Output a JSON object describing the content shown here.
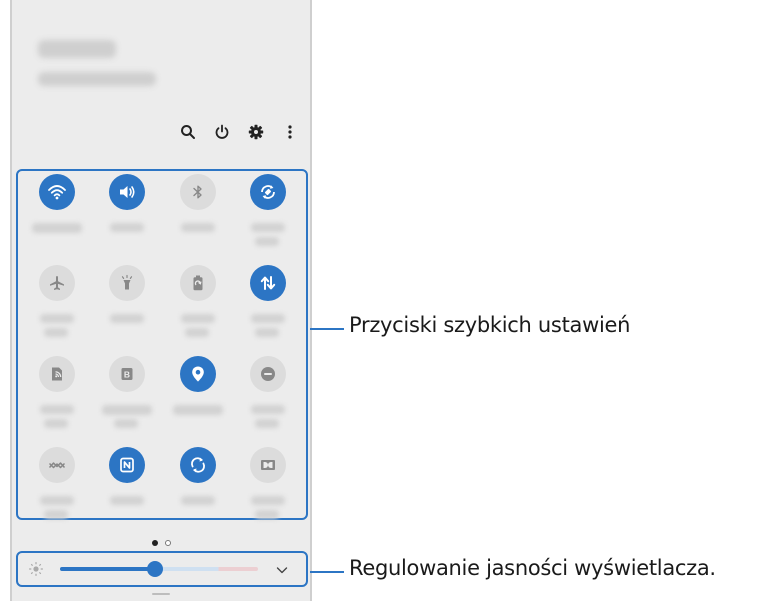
{
  "colors": {
    "accent": "#2c75c4",
    "tile_off": "#dcdcdc",
    "panel_bg": "#ececec"
  },
  "header": {
    "top_icons": [
      "search-icon",
      "power-icon",
      "gear-icon",
      "more-vert-icon"
    ]
  },
  "quick_settings": {
    "tiles": [
      {
        "icon": "wifi-icon",
        "on": true
      },
      {
        "icon": "volume-icon",
        "on": true
      },
      {
        "icon": "bluetooth-icon",
        "on": false
      },
      {
        "icon": "auto-rotate-icon",
        "on": true
      },
      {
        "icon": "airplane-icon",
        "on": false
      },
      {
        "icon": "flashlight-icon",
        "on": false
      },
      {
        "icon": "power-saving-icon",
        "on": false
      },
      {
        "icon": "mobile-data-icon",
        "on": true
      },
      {
        "icon": "mobile-hotspot-icon",
        "on": false
      },
      {
        "icon": "blue-light-filter-icon",
        "on": false
      },
      {
        "icon": "location-icon",
        "on": true
      },
      {
        "icon": "do-not-disturb-icon",
        "on": false
      },
      {
        "icon": "data-saver-icon",
        "on": false
      },
      {
        "icon": "nfc-icon",
        "on": true
      },
      {
        "icon": "sync-icon",
        "on": true
      },
      {
        "icon": "dolby-atmos-icon",
        "on": false
      }
    ],
    "page_indicator": {
      "current": 1,
      "total": 2
    }
  },
  "brightness": {
    "level": 0.48
  },
  "callouts": {
    "quick_buttons": "Przyciski szybkich ustawień",
    "brightness": "Regulowanie jasności wyświetlacza."
  }
}
